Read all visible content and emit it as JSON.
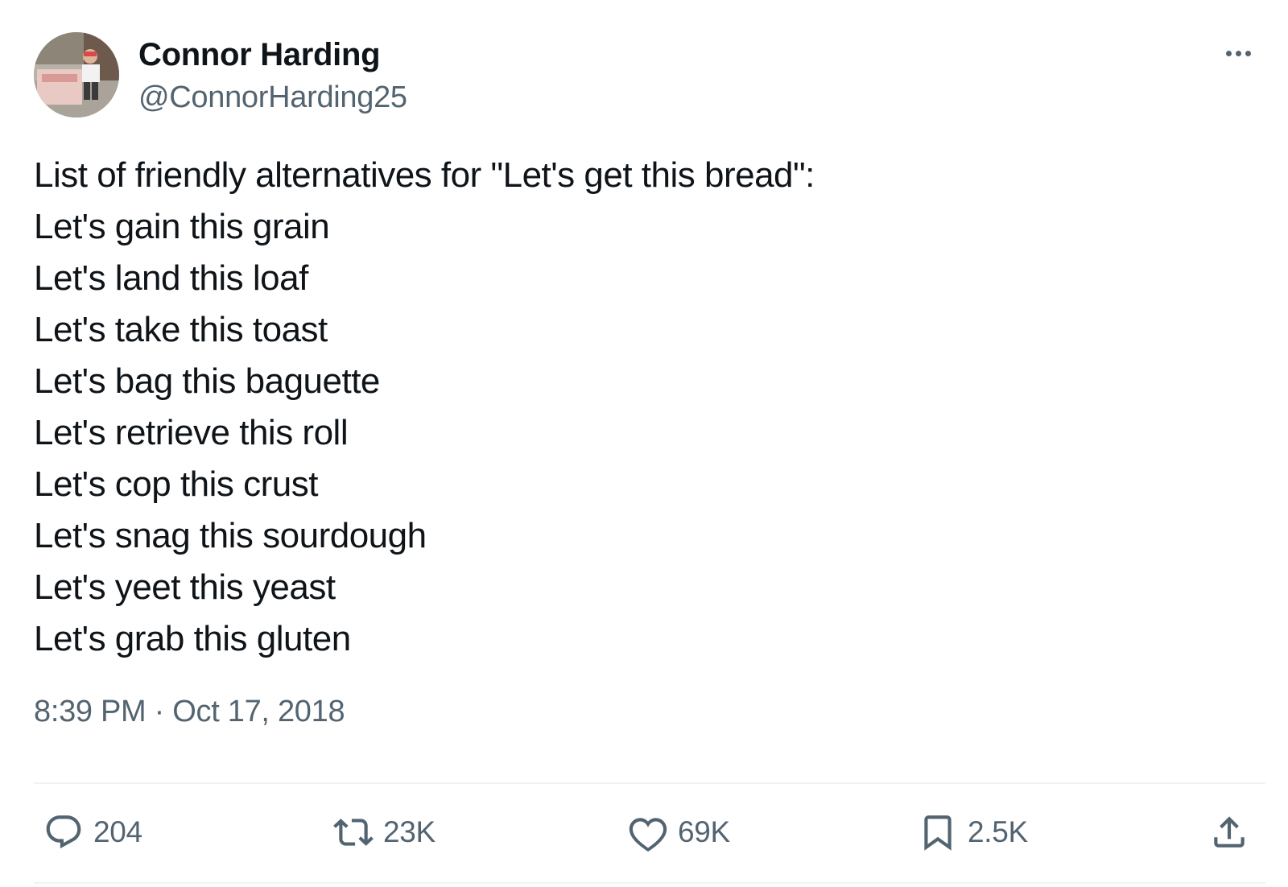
{
  "author": {
    "display_name": "Connor Harding",
    "handle": "@ConnorHarding25"
  },
  "tweet": {
    "lines": [
      "List of friendly alternatives for \"Let's get this bread\":",
      "Let's gain this grain",
      "Let's land this loaf",
      "Let's take this toast",
      "Let's bag this baguette",
      "Let's retrieve this roll",
      "Let's cop this crust",
      "Let's snag this sourdough",
      "Let's yeet this yeast",
      "Let's grab this gluten"
    ],
    "timestamp": "8:39 PM · Oct 17, 2018"
  },
  "actions": {
    "replies": "204",
    "retweets": "23K",
    "likes": "69K",
    "bookmarks": "2.5K"
  },
  "icons": {
    "more": "more-dots-icon",
    "reply": "reply-bubble-icon",
    "retweet": "retweet-arrows-icon",
    "like": "heart-icon",
    "bookmark": "bookmark-icon",
    "share": "share-upload-icon"
  },
  "colors": {
    "text": "#0f1419",
    "secondary": "#536471",
    "divider": "#eff3f4",
    "background": "#ffffff"
  }
}
